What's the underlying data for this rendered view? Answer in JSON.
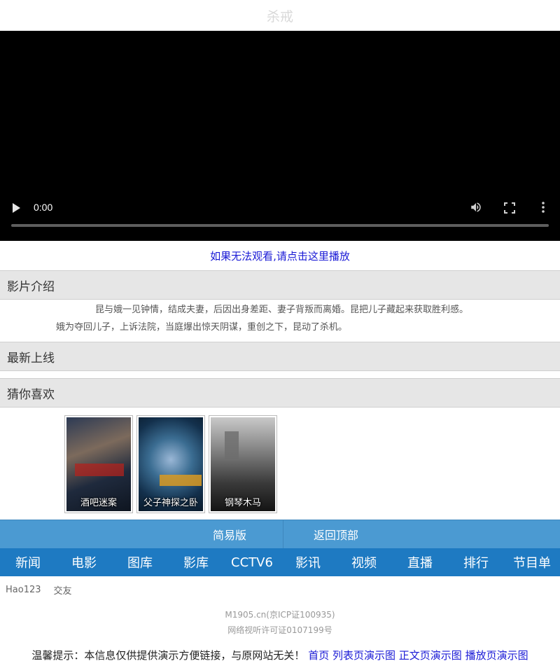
{
  "page": {
    "title": "杀戒"
  },
  "player": {
    "time": "0:00"
  },
  "fallback": {
    "label": "如果无法观看,请点击这里播放"
  },
  "sections": {
    "intro": "影片介绍",
    "latest": "最新上线",
    "recommend": "猜你喜欢"
  },
  "intro": {
    "line1": "昆与娥一见钟情，结成夫妻，后因出身差距、妻子背叛而离婚。昆把儿子藏起来获取胜利感。",
    "line2": "娥为夺回儿子，上诉法院，当庭爆出惊天阴谋，重创之下，昆动了杀机。"
  },
  "recommendations": [
    {
      "title": "酒吧迷案"
    },
    {
      "title": "父子神探之卧"
    },
    {
      "title": "钢琴木马"
    }
  ],
  "bottom_bar": {
    "simple": "简易版",
    "top": "返回顶部"
  },
  "nav": [
    "新闻",
    "电影",
    "图库",
    "影库",
    "CCTV6",
    "影讯",
    "视频",
    "直播",
    "排行",
    "节目单"
  ],
  "links": [
    "Hao123",
    "交友"
  ],
  "footer": {
    "icp": "M1905.cn(京ICP证100935)",
    "license": "网络视听许可证0107199号"
  },
  "notice": {
    "text": "温馨提示：本信息仅供提供演示方便链接，与原网站无关！",
    "links": [
      "首页",
      "列表页演示图",
      "正文页演示图",
      "播放页演示图"
    ]
  }
}
